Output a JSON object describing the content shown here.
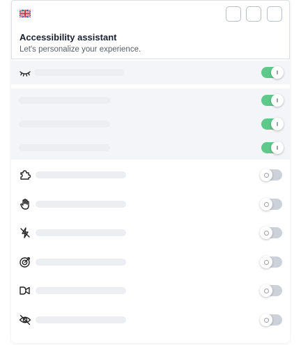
{
  "header": {
    "language_flag": "uk-flag-icon",
    "title": "Accessibility assistant",
    "subtitle": "Let's personalize your experience."
  },
  "colors": {
    "toggle_on": "#5fc88b",
    "toggle_off": "#cdd1d9",
    "row_highlight": "#f4f5f8"
  },
  "features": [
    {
      "icon": "eye-closed-icon",
      "enabled": true
    },
    {
      "icon": "",
      "enabled": true
    },
    {
      "icon": "",
      "enabled": true
    },
    {
      "icon": "",
      "enabled": true
    },
    {
      "icon": "puzzle-icon",
      "enabled": false
    },
    {
      "icon": "hand-icon",
      "enabled": false
    },
    {
      "icon": "flash-off-icon",
      "enabled": false
    },
    {
      "icon": "target-icon",
      "enabled": false
    },
    {
      "icon": "video-camera-icon",
      "enabled": false
    },
    {
      "icon": "eye-off-icon",
      "enabled": false
    }
  ]
}
